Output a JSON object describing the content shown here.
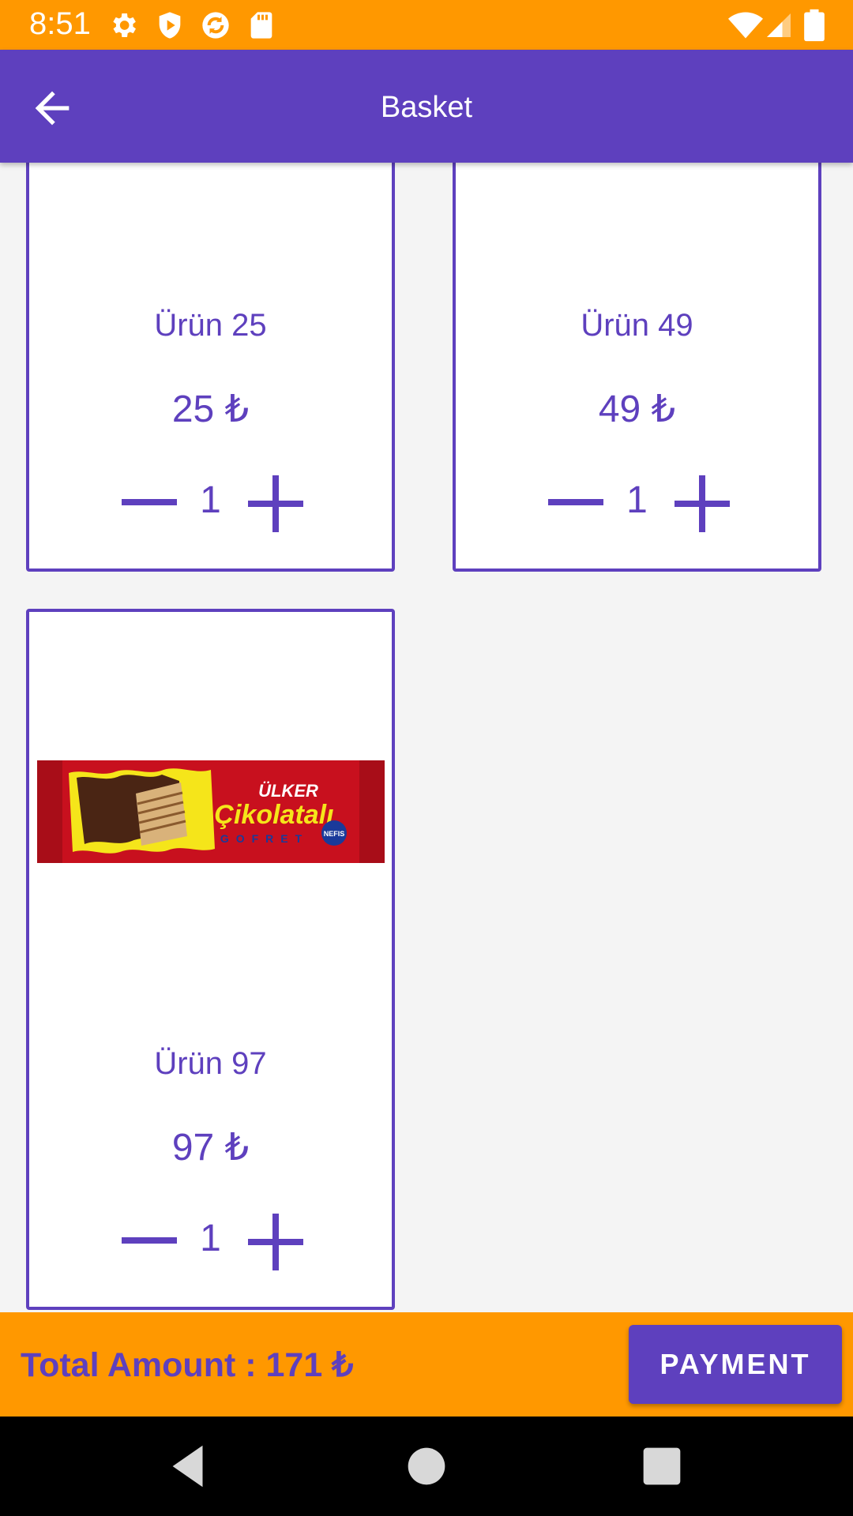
{
  "status_bar": {
    "time": "8:51",
    "left_icons": [
      "gear-icon",
      "shield-play-icon",
      "sync-icon",
      "sd-card-icon"
    ],
    "right_icons": [
      "wifi-icon",
      "signal-icon",
      "battery-icon"
    ]
  },
  "app_bar": {
    "title": "Basket",
    "back_icon": "arrow-back-icon"
  },
  "products": [
    {
      "name": "Ürün 25",
      "price": "25 ₺",
      "quantity": "1",
      "has_image": false
    },
    {
      "name": "Ürün 49",
      "price": "49 ₺",
      "quantity": "1",
      "has_image": false
    },
    {
      "name": "Ürün 97",
      "price": "97 ₺",
      "quantity": "1",
      "has_image": true,
      "image_text": {
        "brand": "ÜLKER",
        "product": "Çikolatalı",
        "sub": "GOFRET",
        "badge": "NEFIS"
      }
    }
  ],
  "footer": {
    "total_label": "Total Amount : 171 ₺",
    "payment_label": "PAYMENT"
  },
  "nav_bar": {
    "icons": [
      "back-triangle-icon",
      "home-circle-icon",
      "recents-square-icon"
    ]
  },
  "colors": {
    "accent_orange": "#FF9800",
    "primary_purple": "#5E40BE",
    "background": "#F4F4F4"
  }
}
